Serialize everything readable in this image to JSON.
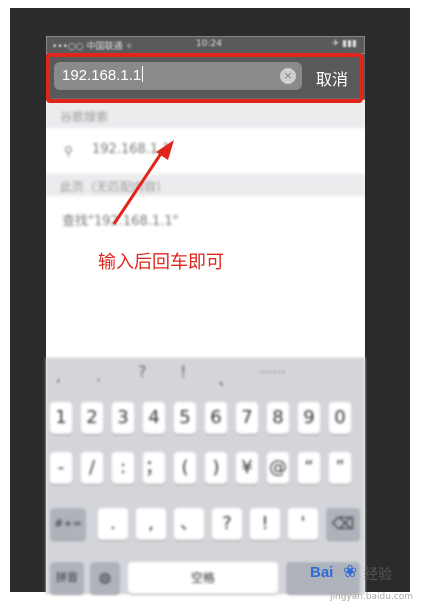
{
  "status": {
    "carrier": "•••○○ 中国联通 ✧",
    "time": "10:24",
    "battery": "✈ ▮▮▮"
  },
  "search": {
    "value": "192.168.1.1",
    "cancel_label": "取消"
  },
  "suggestions": {
    "section1": "谷歌搜索",
    "item1": "192.168.1.1",
    "section2": "此页（无匹配内容）",
    "item2": "查找\"192.168.1.1\""
  },
  "annotation": "输入后回车即可",
  "keyboard": {
    "symbols_row": [
      ",",
      ".",
      "?",
      "!",
      "、",
      "……"
    ],
    "digits": [
      "1",
      "2",
      "3",
      "4",
      "5",
      "6",
      "7",
      "8",
      "9",
      "0"
    ],
    "row2": [
      "-",
      "/",
      ":",
      "；",
      "(",
      ")",
      "¥",
      "@",
      "“",
      "”"
    ],
    "row3_left": "#+=",
    "row3": [
      ".",
      ",",
      "、",
      "?",
      "!",
      "'"
    ],
    "bottom": {
      "lang": "拼音",
      "space": "空格"
    }
  },
  "watermark": {
    "brand": "Bai",
    "brand2": "经验",
    "url": "jingyan.baidu.com"
  },
  "colors": {
    "accent": "#e0251b"
  }
}
